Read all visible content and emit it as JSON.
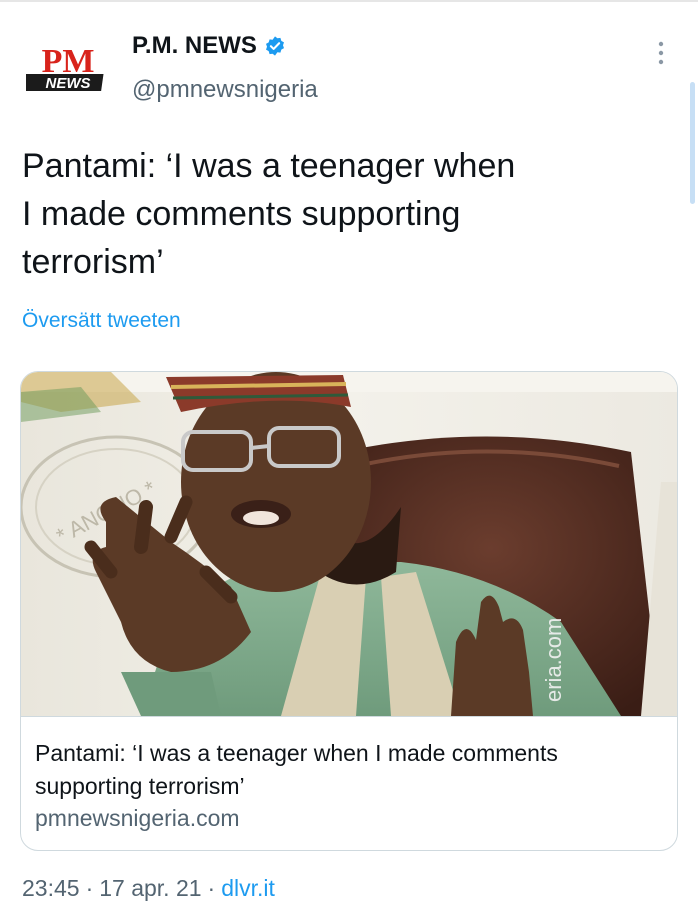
{
  "header": {
    "logo_top": "PM",
    "logo_bottom": "NEWS",
    "account_name": "P.M. NEWS",
    "handle": "@pmnewsnigeria"
  },
  "tweet": {
    "line1": "Pantami: ‘I was a teenager when",
    "line2": "I made comments supporting",
    "line3": "terrorism’",
    "translate": "Översätt tweeten"
  },
  "card": {
    "watermark": "eria.com",
    "title_line1": "Pantami: ‘I was a teenager when I made comments",
    "title_line2": "supporting terrorism’",
    "domain": "pmnewsnigeria.com"
  },
  "meta": {
    "time": "23:45",
    "separator": "·",
    "date": "17 apr. 21",
    "source": "dlvr.it"
  },
  "colors": {
    "accent": "#1d9bf0",
    "secondary_text": "#536471",
    "logo_red": "#d8231b"
  }
}
